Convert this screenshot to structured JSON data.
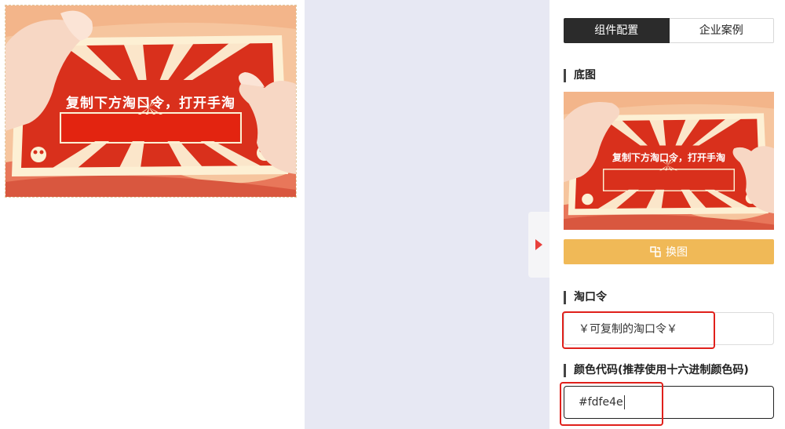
{
  "banner": {
    "command_text": "复制下方淘口令，打开手淘"
  },
  "panel": {
    "tabs": [
      {
        "label": "组件配置",
        "active": true
      },
      {
        "label": "企业案例",
        "active": false
      }
    ],
    "base_image_title": "底图",
    "swap_button_label": "换图",
    "taokouling_title": "淘口令",
    "taokouling_value": "￥可复制的淘口令￥",
    "color_title": "颜色代码(推荐使用十六进制颜色码)",
    "color_value": "#fdfe4e"
  },
  "colors": {
    "accent_red": "#e8403c",
    "swap_button": "#f0b957",
    "banner_red": "#d9301c",
    "banner_cream": "#fdf0d4",
    "highlight": "#e0201b"
  }
}
